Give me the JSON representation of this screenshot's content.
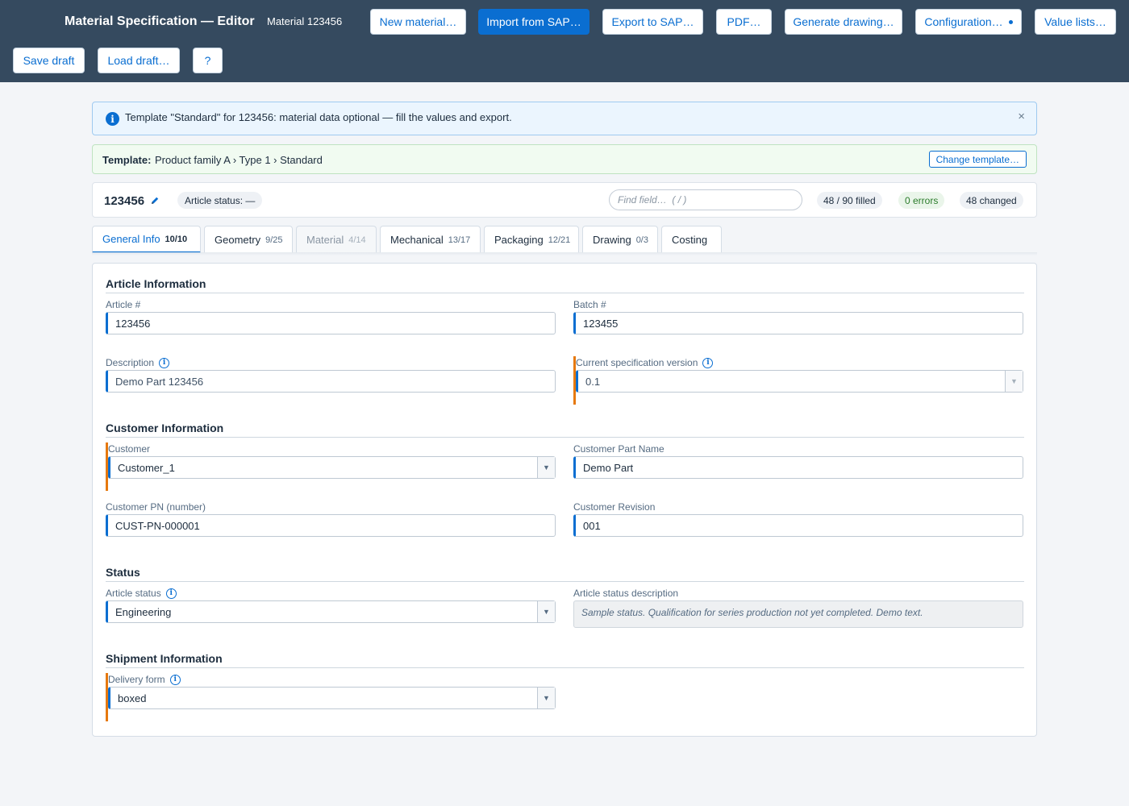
{
  "header": {
    "title": "Material Specification — Editor",
    "subtitle": "Material 123456",
    "buttons": {
      "new_material": "New material…",
      "import_sap": "Import from SAP…",
      "export_sap": "Export to SAP…",
      "pdf": "PDF…",
      "generate_drawing": "Generate drawing…",
      "configuration": "Configuration…",
      "value_lists": "Value lists…",
      "save_draft": "Save draft",
      "load_draft": "Load draft…",
      "help": "?"
    }
  },
  "banner": {
    "text": "Template \"Standard\" for 123456: material data optional — fill the values and export.",
    "close": "×"
  },
  "template": {
    "label": "Template:",
    "path": "Product family A › Type 1 › Standard",
    "change_button": "Change template…"
  },
  "summary": {
    "article_number": "123456",
    "article_status": "Article status: —",
    "find_placeholder": "Find field…  ( / )",
    "filled": "48 / 90 filled",
    "errors": "0 errors",
    "changed": "48 changed"
  },
  "tabs": [
    {
      "label": "General Info",
      "count": "10/10"
    },
    {
      "label": "Geometry",
      "count": "9/25"
    },
    {
      "label": "Material",
      "count": "4/14"
    },
    {
      "label": "Mechanical",
      "count": "13/17"
    },
    {
      "label": "Packaging",
      "count": "12/21"
    },
    {
      "label": "Drawing",
      "count": "0/3"
    },
    {
      "label": "Costing",
      "count": ""
    }
  ],
  "sections": {
    "article": {
      "title": "Article Information",
      "article_no": {
        "label": "Article #",
        "value": "123456"
      },
      "batch_no": {
        "label": "Batch #",
        "value": "123455"
      },
      "description": {
        "label": "Description",
        "value": "Demo Part 123456"
      },
      "spec_version": {
        "label": "Current specification version",
        "value": "0.1"
      }
    },
    "customer": {
      "title": "Customer Information",
      "customer": {
        "label": "Customer",
        "value": "Customer_1"
      },
      "part_name": {
        "label": "Customer Part Name",
        "value": "Demo Part"
      },
      "pn": {
        "label": "Customer PN (number)",
        "value": "CUST-PN-000001"
      },
      "revision": {
        "label": "Customer Revision",
        "value": "001"
      }
    },
    "status": {
      "title": "Status",
      "article_status": {
        "label": "Article status",
        "value": "Engineering"
      },
      "status_desc": {
        "label": "Article status description",
        "value": "Sample status. Qualification for series production not yet completed. Demo text."
      }
    },
    "shipment": {
      "title": "Shipment Information",
      "delivery_form": {
        "label": "Delivery form",
        "value": "boxed"
      }
    }
  },
  "colors": {
    "header_bg": "#354a5f",
    "accent": "#0a6ed1",
    "changed_marker": "#e6790f",
    "info_bg": "#ebf5fe",
    "template_bg": "#f1fbf1"
  },
  "icons": {
    "info": "info-icon",
    "close": "close-icon",
    "edit": "pencil-icon",
    "field_help": "info-circle-icon",
    "dropdown": "chevron-down-icon"
  }
}
